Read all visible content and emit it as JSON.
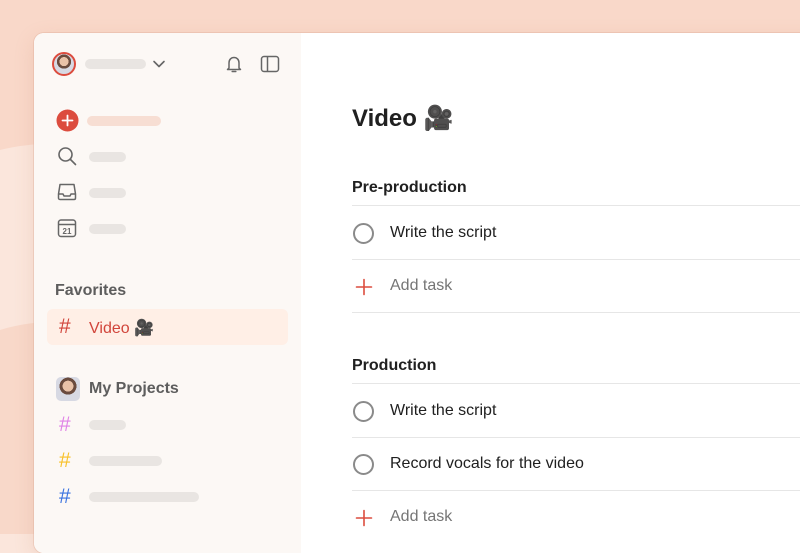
{
  "sidebar": {
    "favorites_label": "Favorites",
    "favorite_item": {
      "label": "Video",
      "emoji": "🎥"
    },
    "projects_label": "My Projects",
    "project_hash_colors": [
      "#e083e6",
      "#f8c12a",
      "#3b73e0"
    ],
    "calendar_day": "21"
  },
  "main": {
    "title": "Video",
    "title_emoji": "🎥",
    "sections": [
      {
        "name": "Pre-production",
        "tasks": [
          "Write the script"
        ],
        "add_label": "Add task"
      },
      {
        "name": "Production",
        "tasks": [
          "Write the script",
          "Record vocals for the video"
        ],
        "add_label": "Add task"
      }
    ]
  },
  "colors": {
    "accent": "#dc4c3e",
    "sidebar_bg": "#fcf8f5",
    "active_bg": "#ffefe6",
    "page_bg": "#fbe6dc"
  },
  "icons": [
    "chevron-down-icon",
    "bell-icon",
    "sidebar-toggle-icon",
    "add-task-icon",
    "search-icon",
    "inbox-icon",
    "calendar-icon",
    "plus-icon"
  ]
}
